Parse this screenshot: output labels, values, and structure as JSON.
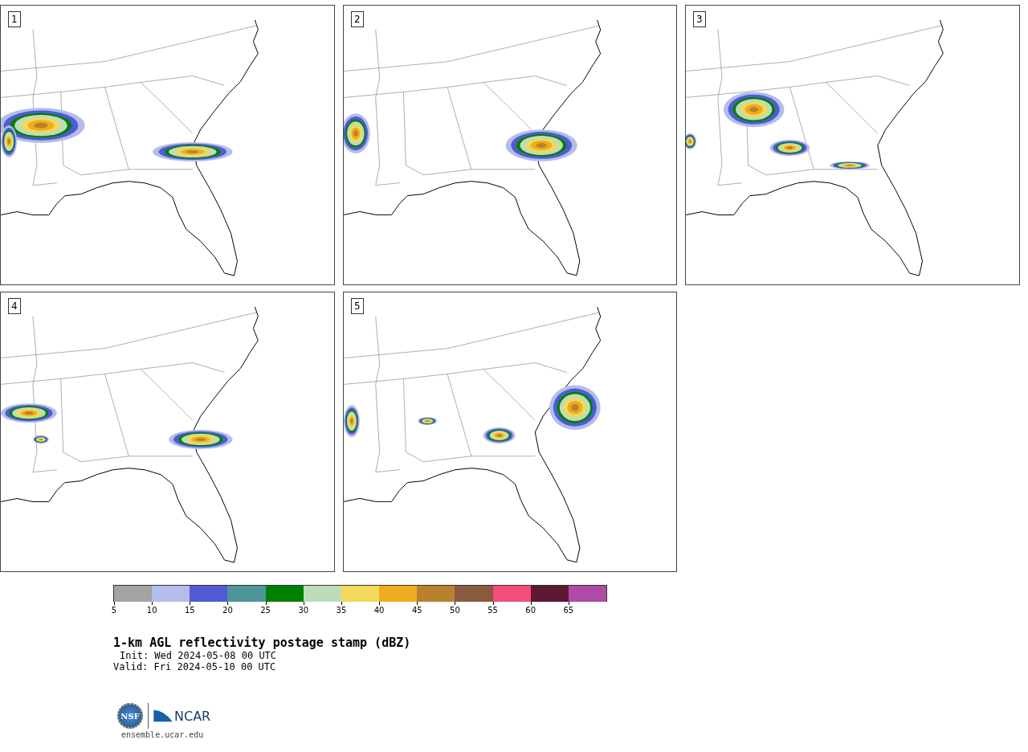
{
  "panels": [
    {
      "number": "1"
    },
    {
      "number": "2"
    },
    {
      "number": "3"
    },
    {
      "number": "4"
    },
    {
      "number": "5"
    }
  ],
  "colorbar": {
    "segments": [
      {
        "color": "#a3a3a3",
        "tick": "5"
      },
      {
        "color": "#b4bde9",
        "tick": "10"
      },
      {
        "color": "#505bd4",
        "tick": "15"
      },
      {
        "color": "#4e9499",
        "tick": "20"
      },
      {
        "color": "#008000",
        "tick": "25"
      },
      {
        "color": "#bddcbc",
        "tick": "30"
      },
      {
        "color": "#f0d95c",
        "tick": "35"
      },
      {
        "color": "#f0ac1c",
        "tick": "40"
      },
      {
        "color": "#b8812e",
        "tick": "45"
      },
      {
        "color": "#8a5a3e",
        "tick": "50"
      },
      {
        "color": "#f24e7a",
        "tick": "55"
      },
      {
        "color": "#5e1735",
        "tick": "60"
      },
      {
        "color": "#ae4ba4",
        "tick": "65"
      }
    ]
  },
  "title": "1-km AGL reflectivity postage stamp (dBZ)",
  "init": "Init: Wed 2024-05-08 00 UTC",
  "valid": "Valid: Fri 2024-05-10 00 UTC",
  "logo": {
    "nsf": "NSF",
    "ncar": "NCAR"
  },
  "site": "ensemble.ucar.edu"
}
